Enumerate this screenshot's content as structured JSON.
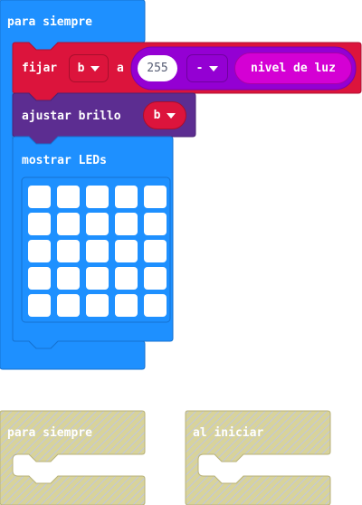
{
  "forever_block": {
    "label": "para siempre"
  },
  "set_block": {
    "label": "fijar",
    "variable": "b",
    "to_label": "a",
    "number": "255",
    "operator": "-",
    "light_level": "nivel de luz"
  },
  "brightness_block": {
    "label": "ajustar brillo",
    "variable": "b"
  },
  "show_leds_block": {
    "label": "mostrar LEDs",
    "grid": [
      [
        0,
        0,
        0,
        0,
        0
      ],
      [
        0,
        0,
        0,
        0,
        0
      ],
      [
        0,
        0,
        0,
        0,
        0
      ],
      [
        0,
        0,
        0,
        0,
        0
      ],
      [
        0,
        0,
        0,
        0,
        0
      ]
    ]
  },
  "ghost_blocks": [
    {
      "label": "para siempre"
    },
    {
      "label": "al iniciar"
    }
  ],
  "colors": {
    "basic": "#1e90ff",
    "variables": "#dc143c",
    "math": "#9400d3",
    "input": "#d400d4",
    "led": "#5c2d91",
    "ghost": "#d4cf8f"
  }
}
